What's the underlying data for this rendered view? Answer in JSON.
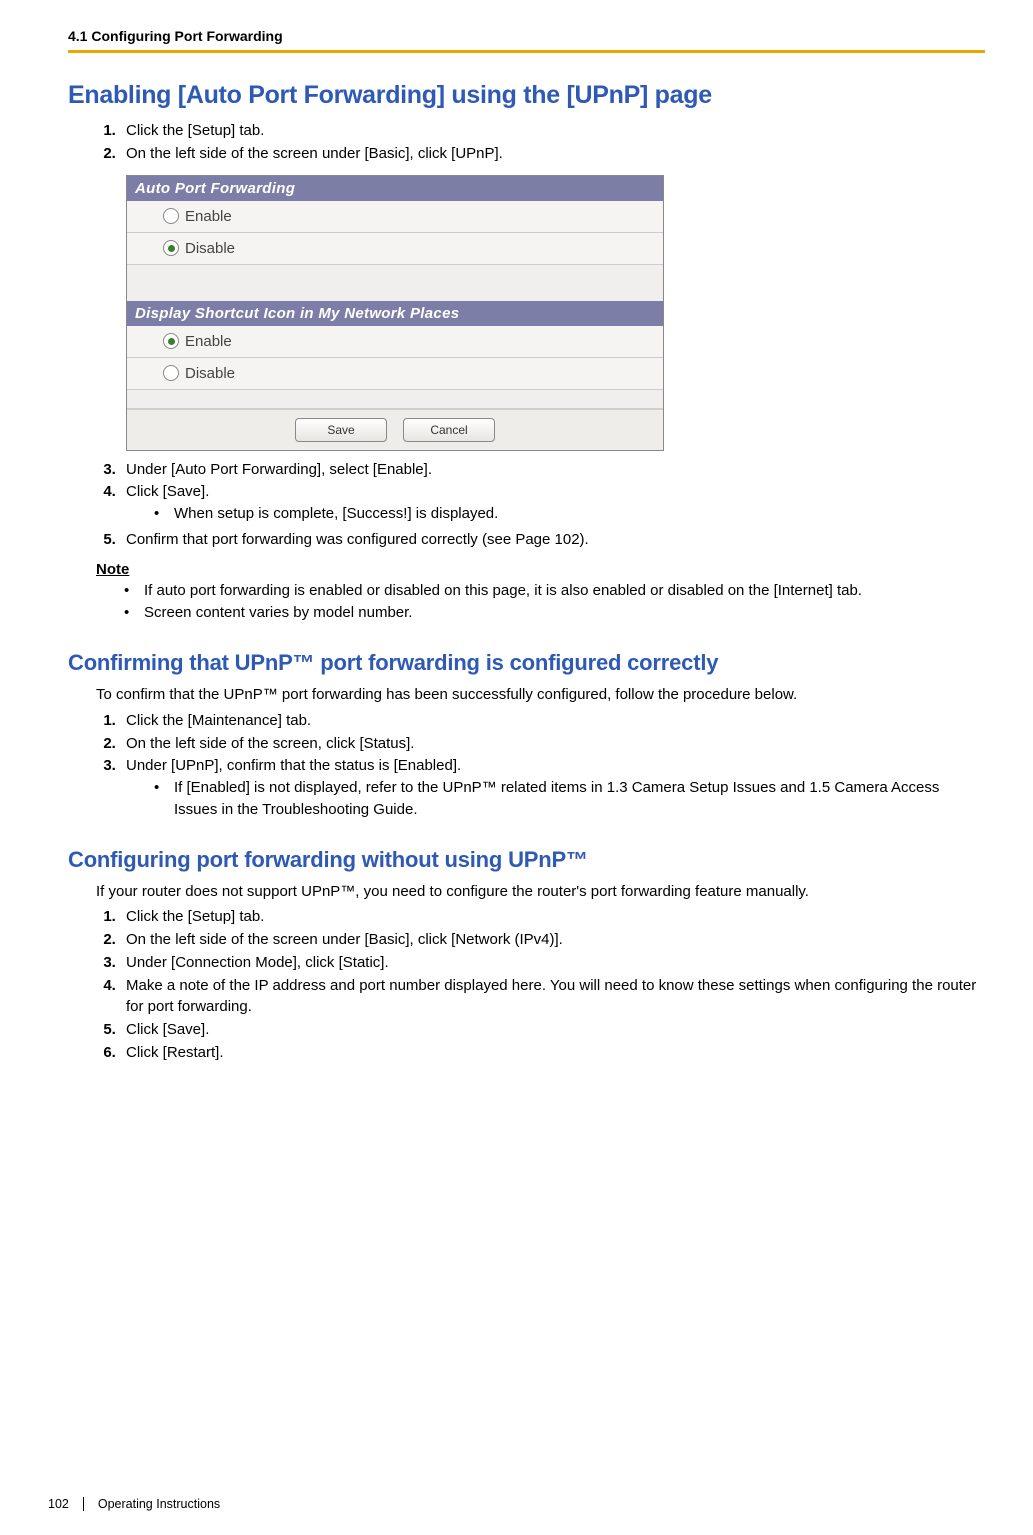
{
  "header": {
    "section": "4.1 Configuring Port Forwarding"
  },
  "h_enabling": "Enabling [Auto Port Forwarding] using the [UPnP] page",
  "steps_enabling": {
    "s1": "Click the [Setup] tab.",
    "s2": "On the left side of the screen under [Basic], click [UPnP]."
  },
  "screenshot": {
    "panel1_title": "Auto Port Forwarding",
    "panel1_opt1": "Enable",
    "panel1_opt2": "Disable",
    "panel2_title": "Display Shortcut Icon in My Network Places",
    "panel2_opt1": "Enable",
    "panel2_opt2": "Disable",
    "btn_save": "Save",
    "btn_cancel": "Cancel"
  },
  "steps_enabling2": {
    "s3": "Under [Auto Port Forwarding], select [Enable].",
    "s4": "Click [Save].",
    "s4b": "When setup is complete, [Success!] is displayed.",
    "s5": "Confirm that port forwarding was configured correctly (see Page 102)."
  },
  "note_label": "Note",
  "note_items": {
    "n1": "If auto port forwarding is enabled or disabled on this page, it is also enabled or disabled on the [Internet] tab.",
    "n2": "Screen content varies by model number."
  },
  "h_confirm": "Confirming that UPnP™ port forwarding is configured correctly",
  "confirm_intro": "To confirm that the UPnP™ port forwarding has been successfully configured, follow the procedure below.",
  "steps_confirm": {
    "s1": "Click the [Maintenance] tab.",
    "s2": "On the left side of the screen, click [Status].",
    "s3": "Under [UPnP], confirm that the status is [Enabled].",
    "s3b": "If [Enabled] is not displayed, refer to the UPnP™ related items in 1.3  Camera Setup Issues and 1.5  Camera Access Issues in the Troubleshooting Guide."
  },
  "h_manual": "Configuring port forwarding without using UPnP™",
  "manual_intro": "If your router does not support UPnP™, you need to configure the router's port forwarding feature manually.",
  "steps_manual": {
    "s1": "Click the [Setup] tab.",
    "s2": "On the left side of the screen under [Basic], click [Network (IPv4)].",
    "s3": "Under [Connection Mode], click [Static].",
    "s4": "Make a note of the IP address and port number displayed here. You will need to know these settings when configuring the router for port forwarding.",
    "s5": "Click [Save].",
    "s6": "Click [Restart]."
  },
  "footer": {
    "page": "102",
    "doc": "Operating Instructions"
  }
}
